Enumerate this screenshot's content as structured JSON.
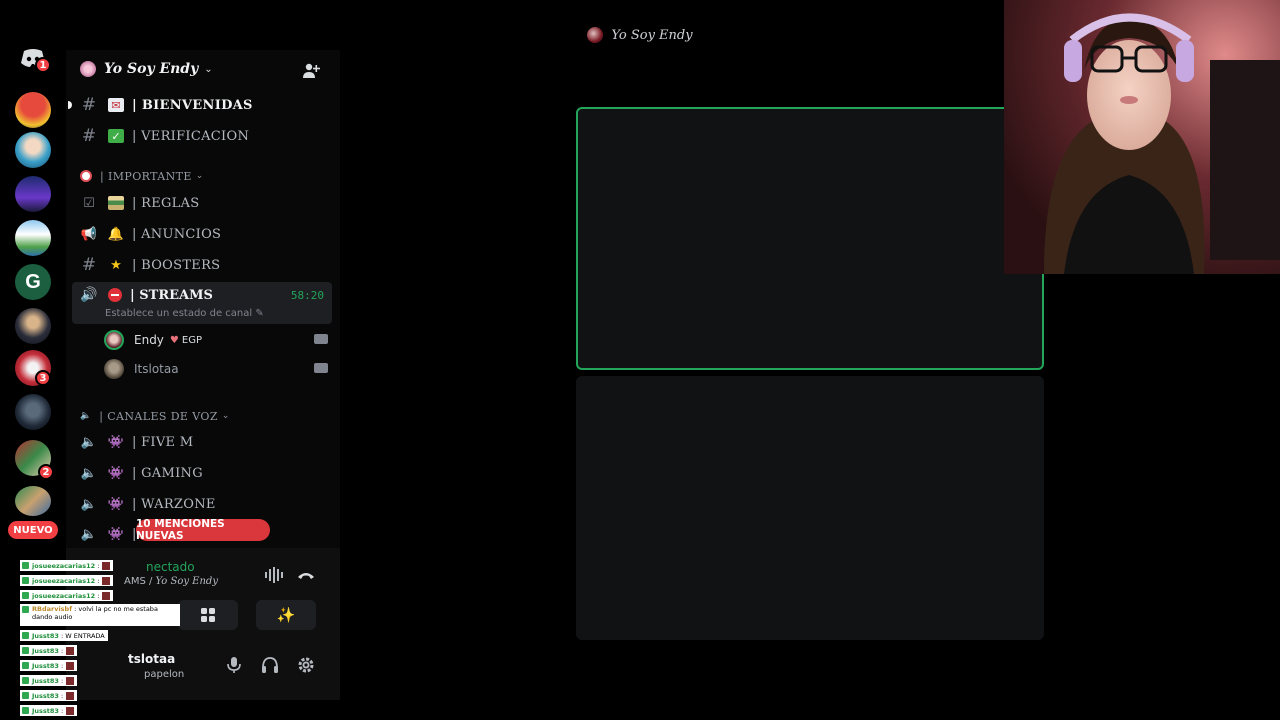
{
  "window": {
    "title": "Yo Soy Endy"
  },
  "rail": {
    "discord_badge": "1",
    "server_badges": [
      "3",
      "2"
    ],
    "new_label": "NUEVO"
  },
  "server": {
    "name": "Yo Soy Endy"
  },
  "channels": [
    {
      "label": "| BIENVENIDAS",
      "emoji": "envelope"
    },
    {
      "label": "| VERIFICACION",
      "emoji": "check-box"
    }
  ],
  "categories": [
    {
      "label": "| IMPORTANTE"
    },
    {
      "label": "| CANALES DE VOZ"
    }
  ],
  "important_channels": [
    {
      "label": "| REGLAS",
      "emoji": "books"
    },
    {
      "label": "| ANUNCIOS",
      "emoji": "bell"
    },
    {
      "label": "| BOOSTERS",
      "emoji": "star"
    }
  ],
  "active_channel": {
    "label": "| STREAMS",
    "emoji": "no-entry",
    "timer": "58:20",
    "status": "Establece un estado de canal"
  },
  "voice_users": [
    {
      "name": "Endy",
      "tag": "EGP"
    },
    {
      "name": "Itslotaa"
    }
  ],
  "voice_channels": [
    {
      "label": "| FIVE M"
    },
    {
      "label": "| GAMING"
    },
    {
      "label": "| WARZONE"
    },
    {
      "label": "|"
    }
  ],
  "mentions_pill": "10 MENCIONES NUEVAS",
  "voice_panel": {
    "status": "nectado",
    "channel_path": "AMS / ",
    "server_italic": "Yo Soy Endy",
    "username": "tslotaa",
    "user_status": "papelon"
  },
  "chat": [
    {
      "user": "josueezacarias12",
      "text": ":"
    },
    {
      "user": "josueezacarias12",
      "text": ":"
    },
    {
      "user": "josueezacarias12",
      "text": ":"
    },
    {
      "user": "RBdarvisbf",
      "text": ": volvi la pc no me estaba dando audio"
    },
    {
      "user": "Jusst83",
      "text": ": W ENTRADA"
    },
    {
      "user": "Jusst83",
      "text": ":"
    },
    {
      "user": "Jusst83",
      "text": ":"
    },
    {
      "user": "Jusst83",
      "text": ":"
    },
    {
      "user": "Jusst83",
      "text": ":"
    },
    {
      "user": "Jusst83",
      "text": ":"
    }
  ],
  "colors": {
    "accent_green": "#23a55a",
    "danger_red": "#f23f43",
    "background": "#000000",
    "sidebar": "#080808"
  }
}
